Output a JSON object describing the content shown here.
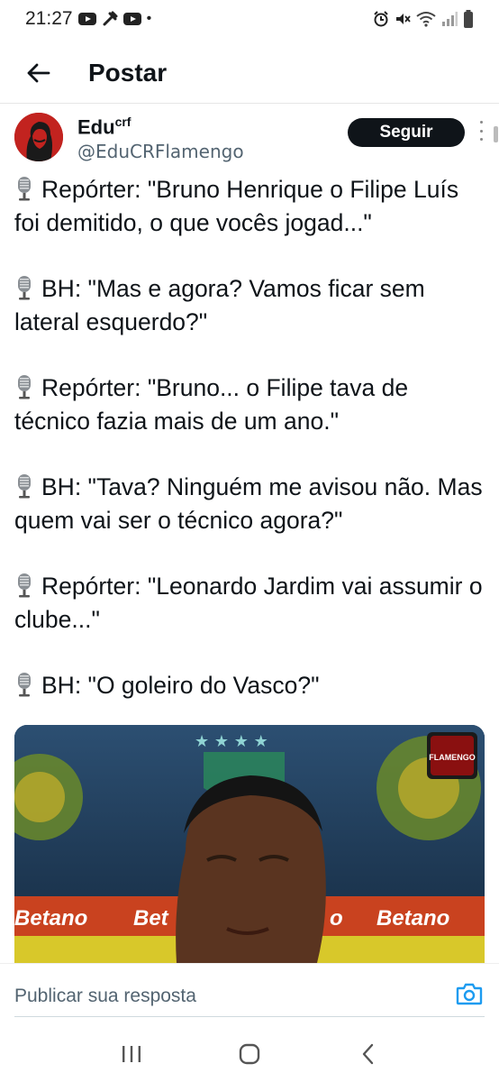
{
  "status_bar": {
    "time": "21:27",
    "dot": "•",
    "left_icons": [
      "youtube-icon",
      "tools-icon",
      "youtube-icon"
    ],
    "right_icons": [
      "alarm-icon",
      "mute-icon",
      "wifi-icon",
      "signal-icon",
      "battery-icon"
    ]
  },
  "header": {
    "title": "Postar",
    "back_icon": "arrow-left-icon"
  },
  "post": {
    "author": {
      "name": "Edu",
      "name_sup": "crf",
      "handle": "@EduCRFlamengo"
    },
    "follow_label": "Seguir",
    "paragraphs": [
      "Repórter: \"Bruno Henrique o Filipe Luís foi demitido, o que vocês jogad...\"",
      "BH: \"Mas e agora? Vamos ficar sem lateral esquerdo?\"",
      "Repórter: \"Bruno... o Filipe tava de técnico fazia mais de um ano.\"",
      "BH: \"Tava? Ninguém me avisou não. Mas quem vai ser o técnico agora?\"",
      "Repórter: \"Leonardo Jardim vai assumir o clube...\"",
      "BH: \"O goleiro do Vasco?\""
    ],
    "media": {
      "sponsor_labels": [
        "Betano",
        "Bet",
        "o",
        "Betano"
      ],
      "watermark": "FLAMENGO"
    }
  },
  "reply": {
    "placeholder": "Publicar sua resposta"
  },
  "colors": {
    "text": "#0f1419",
    "secondary": "#536471",
    "accent": "#1d9bf0",
    "follow_bg": "#0f1419"
  }
}
